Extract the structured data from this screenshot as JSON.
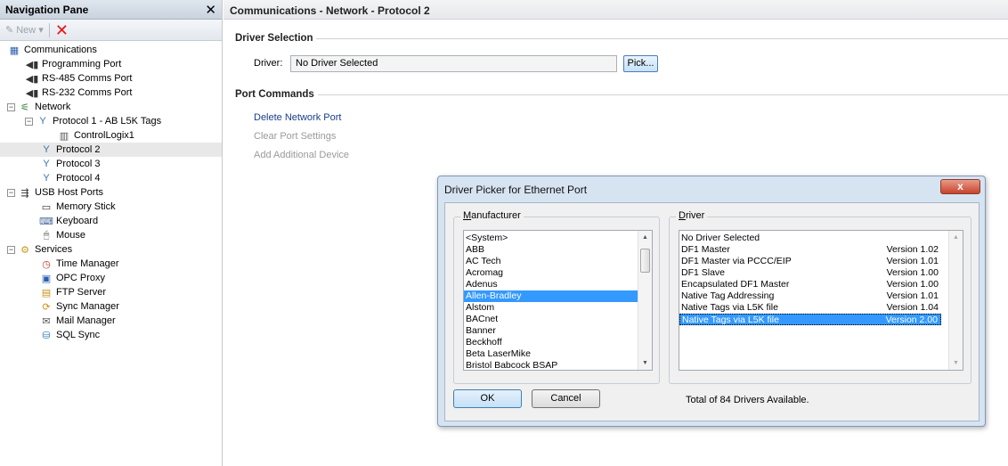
{
  "nav": {
    "title": "Navigation Pane",
    "close_glyph": "✕",
    "toolbar": {
      "new_label": "New ▾"
    },
    "tree": [
      {
        "label": "Communications",
        "icon": "communications-icon",
        "indent": 0,
        "exp": "",
        "glyph": "▦",
        "color": "#2a5db0"
      },
      {
        "label": "Programming Port",
        "icon": "port-icon",
        "indent": 1,
        "exp": "",
        "glyph": "◀▮",
        "color": "#333"
      },
      {
        "label": "RS-485 Comms Port",
        "icon": "port-icon",
        "indent": 1,
        "exp": "",
        "glyph": "◀▮",
        "color": "#333"
      },
      {
        "label": "RS-232 Comms Port",
        "icon": "port-icon",
        "indent": 1,
        "exp": "",
        "glyph": "◀▮",
        "color": "#333"
      },
      {
        "label": "Network",
        "icon": "network-icon",
        "indent": 0,
        "exp": "−",
        "glyph": "⚟",
        "color": "#2d7a2d"
      },
      {
        "label": "Protocol 1 - AB L5K Tags",
        "icon": "protocol-icon",
        "indent": 1,
        "exp": "−",
        "glyph": "Y",
        "color": "#3a6fb0"
      },
      {
        "label": "ControlLogix1",
        "icon": "device-icon",
        "indent": 3,
        "exp": "",
        "glyph": "▥",
        "color": "#555"
      },
      {
        "label": "Protocol 2",
        "icon": "protocol-icon",
        "indent": 2,
        "exp": "",
        "glyph": "Y",
        "color": "#3a6fb0",
        "selected": true
      },
      {
        "label": "Protocol 3",
        "icon": "protocol-icon",
        "indent": 2,
        "exp": "",
        "glyph": "Y",
        "color": "#3a6fb0"
      },
      {
        "label": "Protocol 4",
        "icon": "protocol-icon",
        "indent": 2,
        "exp": "",
        "glyph": "Y",
        "color": "#3a6fb0"
      },
      {
        "label": "USB Host Ports",
        "icon": "usb-icon",
        "indent": 0,
        "exp": "−",
        "glyph": "⇶",
        "color": "#333"
      },
      {
        "label": "Memory Stick",
        "icon": "memory-stick-icon",
        "indent": 2,
        "exp": "",
        "glyph": "▭",
        "color": "#333"
      },
      {
        "label": "Keyboard",
        "icon": "keyboard-icon",
        "indent": 2,
        "exp": "",
        "glyph": "⌨",
        "color": "#4a6a9a"
      },
      {
        "label": "Mouse",
        "icon": "mouse-icon",
        "indent": 2,
        "exp": "",
        "glyph": "🖱",
        "color": "#666"
      },
      {
        "label": "Services",
        "icon": "services-icon",
        "indent": 0,
        "exp": "−",
        "glyph": "⚙",
        "color": "#c89a1a"
      },
      {
        "label": "Time Manager",
        "icon": "time-manager-icon",
        "indent": 2,
        "exp": "",
        "glyph": "◷",
        "color": "#c0392b"
      },
      {
        "label": "OPC Proxy",
        "icon": "opc-proxy-icon",
        "indent": 2,
        "exp": "",
        "glyph": "▣",
        "color": "#2a5db0"
      },
      {
        "label": "FTP Server",
        "icon": "ftp-server-icon",
        "indent": 2,
        "exp": "",
        "glyph": "▤",
        "color": "#c8901a"
      },
      {
        "label": "Sync Manager",
        "icon": "sync-manager-icon",
        "indent": 2,
        "exp": "",
        "glyph": "⟳",
        "color": "#c8901a"
      },
      {
        "label": "Mail Manager",
        "icon": "mail-manager-icon",
        "indent": 2,
        "exp": "",
        "glyph": "✉",
        "color": "#555"
      },
      {
        "label": "SQL Sync",
        "icon": "sql-sync-icon",
        "indent": 2,
        "exp": "",
        "glyph": "⛁",
        "color": "#2a7ab0"
      }
    ]
  },
  "main": {
    "title": "Communications - Network - Protocol 2",
    "driver_selection_header": "Driver Selection",
    "driver_label": "Driver:",
    "driver_value": "No Driver Selected",
    "pick_label": "Pick...",
    "port_commands_header": "Port Commands",
    "commands": [
      {
        "label": "Delete Network Port",
        "enabled": true
      },
      {
        "label": "Clear Port Settings",
        "enabled": false
      },
      {
        "label": "Add Additional Device",
        "enabled": false
      }
    ]
  },
  "dialog": {
    "title": "Driver Picker for Ethernet Port",
    "close_glyph": "x",
    "manufacturer_label": "Manufacturer",
    "driver_label": "Driver",
    "manufacturers": [
      "<System>",
      "ABB",
      "AC Tech",
      "Acromag",
      "Adenus",
      "Allen-Bradley",
      "Alstom",
      "BACnet",
      "Banner",
      "Beckhoff",
      "Beta LaserMike",
      "Bristol Babcock BSAP"
    ],
    "selected_manufacturer": "Allen-Bradley",
    "drivers": [
      {
        "name": "No Driver Selected",
        "version": ""
      },
      {
        "name": "DF1 Master",
        "version": "Version 1.02"
      },
      {
        "name": "DF1 Master via PCCC/EIP",
        "version": "Version 1.01"
      },
      {
        "name": "DF1 Slave",
        "version": "Version 1.00"
      },
      {
        "name": "Encapsulated DF1 Master",
        "version": "Version 1.00"
      },
      {
        "name": "Native Tag Addressing",
        "version": "Version 1.01"
      },
      {
        "name": "Native Tags via L5K file",
        "version": "Version 1.04"
      },
      {
        "name": "Native Tags via L5K file",
        "version": "Version 2.00"
      }
    ],
    "selected_driver_index": 7,
    "ok_label": "OK",
    "cancel_label": "Cancel",
    "total_text": "Total of 84 Drivers Available."
  }
}
